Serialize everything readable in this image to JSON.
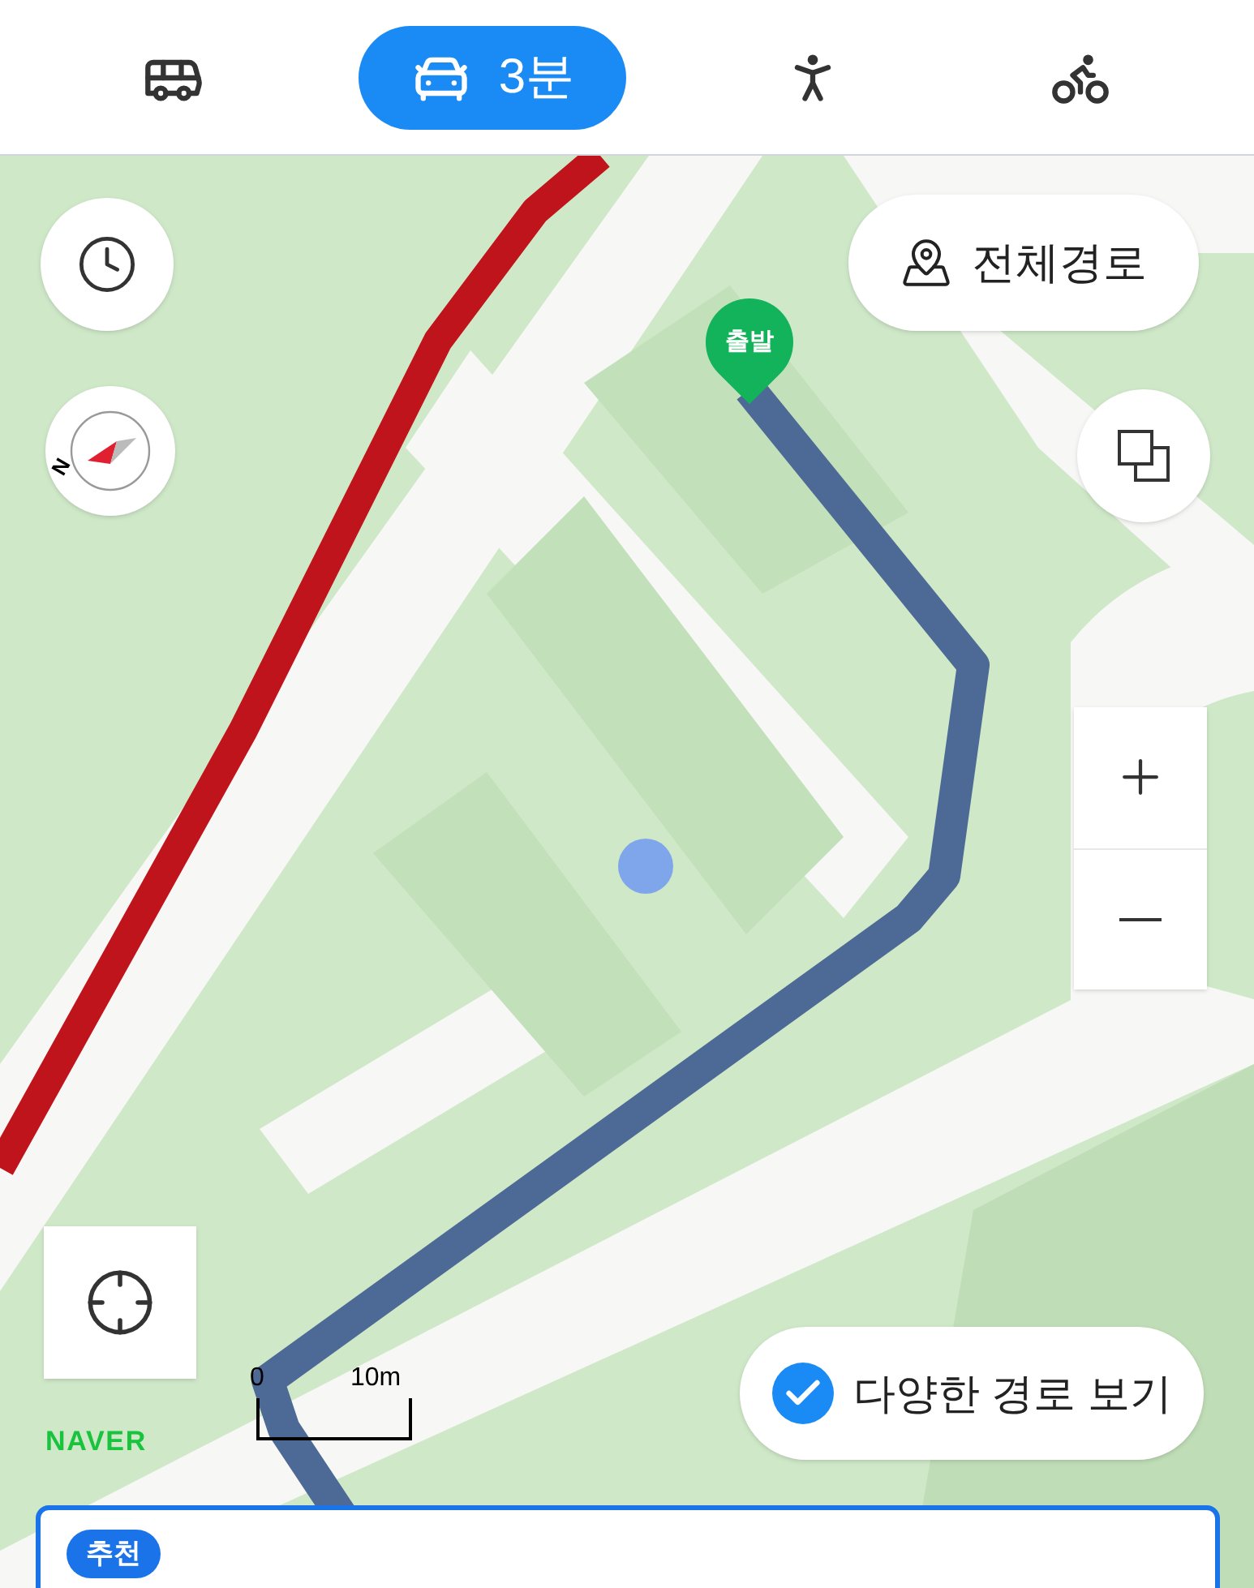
{
  "modes": [
    {
      "kind": "bus",
      "selected": false
    },
    {
      "kind": "car",
      "selected": true,
      "label": "3분"
    },
    {
      "kind": "walk",
      "selected": false
    },
    {
      "kind": "bike",
      "selected": false
    }
  ],
  "map": {
    "start_marker": "출발",
    "full_route_button": "전체경로",
    "compass_label": "N",
    "logo": "NAVER",
    "scale": {
      "start": "0",
      "end": "10m"
    },
    "alternatives": {
      "label": "다양한 경로 보기",
      "checked": true
    }
  },
  "route_card": {
    "badge": "추천"
  }
}
